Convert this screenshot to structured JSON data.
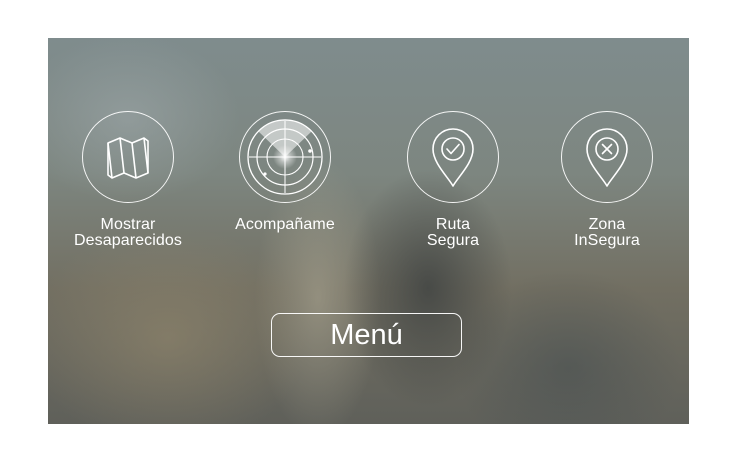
{
  "menu_items": [
    {
      "label": "Mostrar\nDesaparecidos",
      "icon": "map-icon"
    },
    {
      "label": "Acompañame",
      "icon": "radar-icon"
    },
    {
      "label": "Ruta\nSegura",
      "icon": "location-check-icon"
    },
    {
      "label": "Zona\nInSegura",
      "icon": "location-cross-icon"
    }
  ],
  "menu_button": {
    "label": "Menú"
  }
}
